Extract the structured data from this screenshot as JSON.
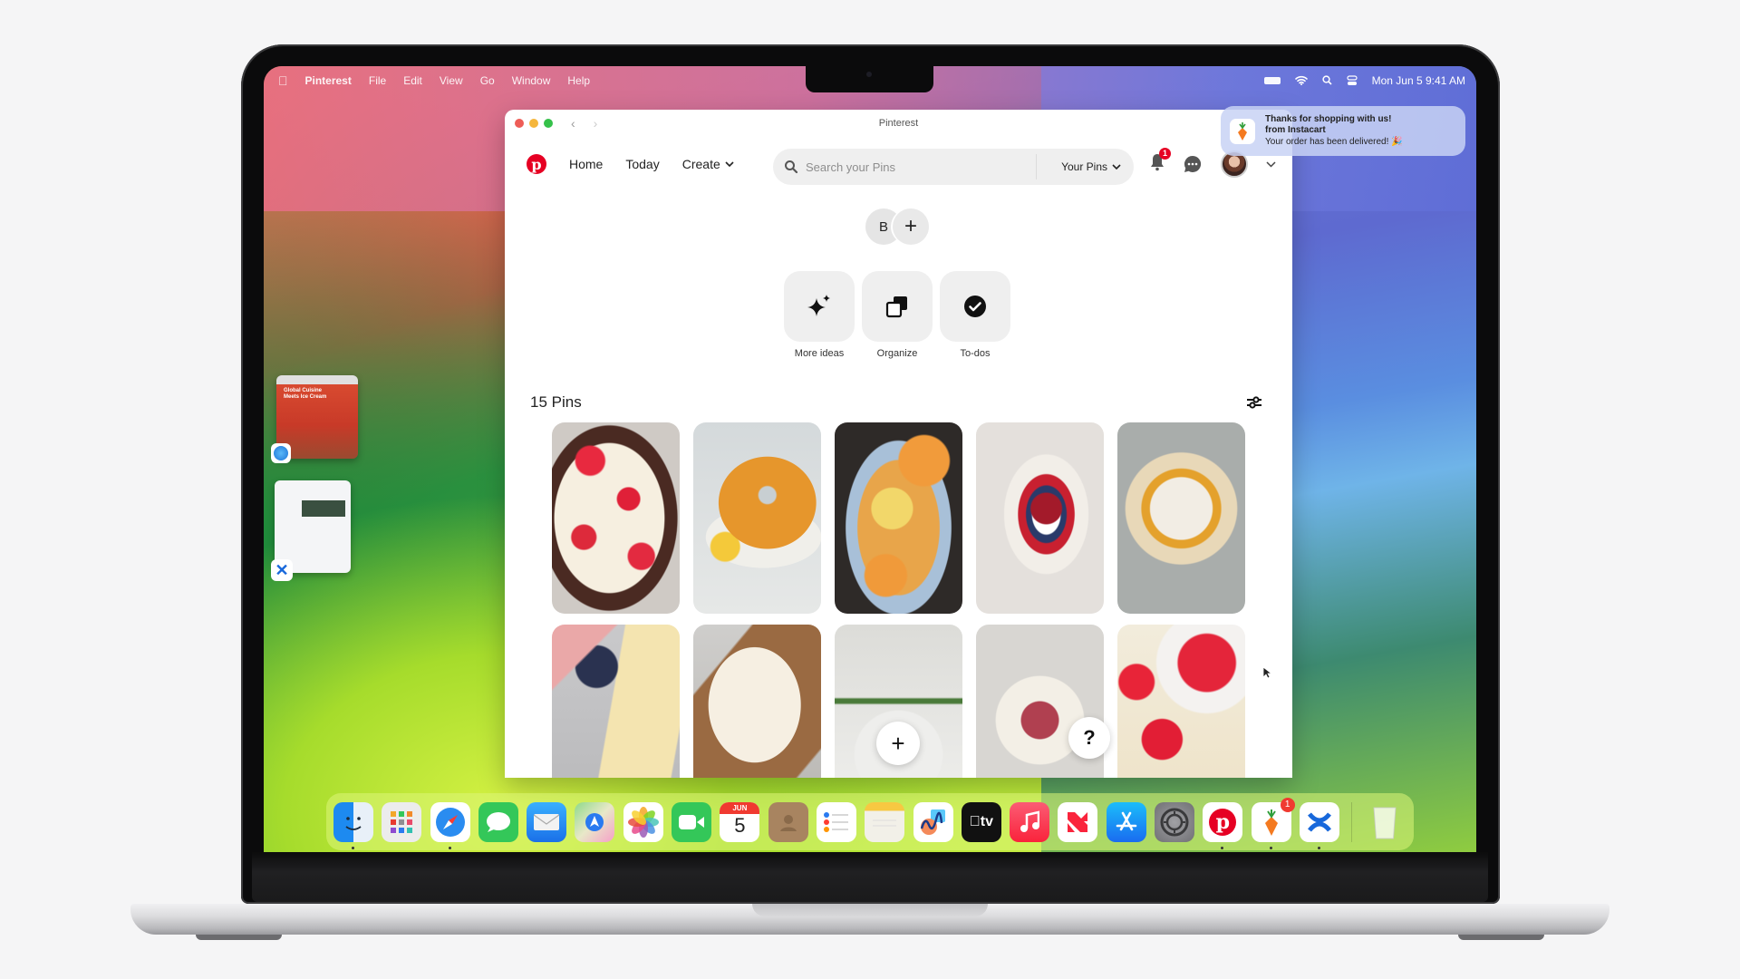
{
  "menubar": {
    "app_name": "Pinterest",
    "items": [
      "File",
      "Edit",
      "View",
      "Go",
      "Window",
      "Help"
    ],
    "clock": "Mon Jun 5  9:41 AM",
    "status_icons": [
      "battery-icon",
      "wifi-icon",
      "spotlight-search-icon",
      "control-center-icon"
    ]
  },
  "notification": {
    "title": "Thanks for shopping with us!",
    "source": "from Instacart",
    "body": "Your order has been delivered! 🎉"
  },
  "window": {
    "title": "Pinterest",
    "nav": {
      "home": "Home",
      "today": "Today",
      "create": "Create"
    },
    "search": {
      "placeholder": "Search your Pins",
      "value": "",
      "scope": "Your Pins"
    },
    "notifications_count": "1",
    "board_initial": "B",
    "tools": [
      {
        "label": "More ideas",
        "icon": "sparkle-icon"
      },
      {
        "label": "Organize",
        "icon": "organize-icon"
      },
      {
        "label": "To-dos",
        "icon": "checkmark-icon"
      }
    ],
    "pins_count_label": "15 Pins",
    "pins": [
      {
        "name": "raspberry-tart"
      },
      {
        "name": "lemon-bundt-cake"
      },
      {
        "name": "apricot-flower-cake"
      },
      {
        "name": "berry-pavlova-wreath"
      },
      {
        "name": "lemon-meringue-tart"
      },
      {
        "name": "berry-sheet-cake"
      },
      {
        "name": "pecan-frosted-cake"
      },
      {
        "name": "cheesecake-slice"
      },
      {
        "name": "strawberry-cream-cake"
      },
      {
        "name": "cherry-cheesecake-bars"
      }
    ],
    "add_button_label": "+",
    "help_button_label": "?"
  },
  "stage_manager": [
    {
      "app": "Safari",
      "preview_title": "Global Cuisine Meets Ice Cream"
    },
    {
      "app": "Confluence"
    }
  ],
  "dock": {
    "items": [
      {
        "name": "Finder",
        "running": true
      },
      {
        "name": "Launchpad",
        "running": false
      },
      {
        "name": "Safari",
        "running": true
      },
      {
        "name": "Messages",
        "running": false
      },
      {
        "name": "Mail",
        "running": false
      },
      {
        "name": "Maps",
        "running": false
      },
      {
        "name": "Photos",
        "running": false
      },
      {
        "name": "FaceTime",
        "running": false
      },
      {
        "name": "Calendar",
        "running": false,
        "month": "JUN",
        "day": "5"
      },
      {
        "name": "Contacts",
        "running": false
      },
      {
        "name": "Reminders",
        "running": false
      },
      {
        "name": "Notes",
        "running": false
      },
      {
        "name": "Freeform",
        "running": false
      },
      {
        "name": "TV",
        "running": false,
        "label": "tv"
      },
      {
        "name": "Music",
        "running": false
      },
      {
        "name": "News",
        "running": false
      },
      {
        "name": "App Store",
        "running": false
      },
      {
        "name": "System Settings",
        "running": false
      },
      {
        "name": "Pinterest",
        "running": true
      },
      {
        "name": "Instacart",
        "running": true,
        "badge": "1"
      },
      {
        "name": "Confluence",
        "running": true
      },
      {
        "name": "Trash",
        "running": false
      }
    ]
  },
  "colors": {
    "pinterest_red": "#e60023",
    "badge_red": "#e60023"
  }
}
